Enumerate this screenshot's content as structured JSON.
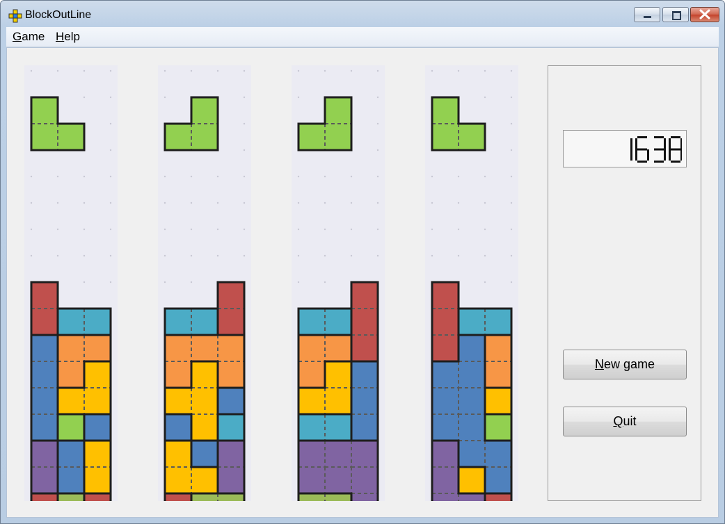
{
  "window": {
    "title": "BlockOutLine"
  },
  "menu": {
    "items": [
      {
        "label": "Game",
        "accel": "G",
        "rest": "ame"
      },
      {
        "label": "Help",
        "accel": "H",
        "rest": "elp"
      }
    ]
  },
  "score": {
    "value": "1638"
  },
  "buttons": {
    "new_game": {
      "label": "New game",
      "accel": "N",
      "rest": "ew game"
    },
    "quit": {
      "label": "Quit",
      "accel": "Q",
      "rest": "uit"
    }
  },
  "colors": {
    "green": "#92d050",
    "olive": "#9bbb59",
    "red": "#c0504d",
    "blue": "#4f81bd",
    "teal": "#4bacc6",
    "orange": "#f79646",
    "yellow": "#ffc000",
    "purple": "#8064a2",
    "board_bg": "#ebebf3",
    "grid_dot": "#c8c8d4"
  },
  "boards": [
    {
      "preview": [
        [
          0,
          0,
          "green"
        ],
        [
          0,
          1,
          "green"
        ],
        [
          1,
          1,
          "green"
        ]
      ],
      "grid": [
        [
          null,
          null,
          null
        ],
        [
          "red",
          null,
          null
        ],
        [
          "red",
          "teal",
          "teal"
        ],
        [
          "blue",
          "orange",
          "orange"
        ],
        [
          "blue",
          "orange",
          "yellow"
        ],
        [
          "blue",
          "yellow",
          "yellow"
        ],
        [
          "blue",
          "green",
          "blue"
        ],
        [
          "purple",
          "blue",
          "yellow"
        ],
        [
          "purple",
          "blue",
          "yellow"
        ],
        [
          "red",
          "olive",
          "red"
        ]
      ]
    },
    {
      "preview": [
        [
          1,
          0,
          "green"
        ],
        [
          0,
          1,
          "green"
        ],
        [
          1,
          1,
          "green"
        ]
      ],
      "grid": [
        [
          null,
          null,
          null
        ],
        [
          null,
          null,
          "red"
        ],
        [
          "teal",
          "teal",
          "red"
        ],
        [
          "orange",
          "orange",
          "orange"
        ],
        [
          "orange",
          "yellow",
          "orange"
        ],
        [
          "yellow",
          "yellow",
          "blue"
        ],
        [
          "blue",
          "yellow",
          "teal"
        ],
        [
          "yellow",
          "blue",
          "purple"
        ],
        [
          "yellow",
          "yellow",
          "purple"
        ],
        [
          "red",
          "olive",
          "olive"
        ]
      ]
    },
    {
      "preview": [
        [
          1,
          0,
          "green"
        ],
        [
          0,
          1,
          "green"
        ],
        [
          1,
          1,
          "green"
        ]
      ],
      "grid": [
        [
          null,
          null,
          null
        ],
        [
          null,
          null,
          "red"
        ],
        [
          "teal",
          "teal",
          "red"
        ],
        [
          "orange",
          "orange",
          "red"
        ],
        [
          "orange",
          "yellow",
          "blue"
        ],
        [
          "yellow",
          "yellow",
          "blue"
        ],
        [
          "teal",
          "teal",
          "blue"
        ],
        [
          "purple",
          "purple",
          "purple"
        ],
        [
          "purple",
          "purple",
          "purple"
        ],
        [
          "olive",
          "olive",
          "purple"
        ]
      ]
    },
    {
      "preview": [
        [
          0,
          0,
          "green"
        ],
        [
          0,
          1,
          "green"
        ],
        [
          1,
          1,
          "green"
        ]
      ],
      "grid": [
        [
          null,
          null,
          null
        ],
        [
          "red",
          null,
          null
        ],
        [
          "red",
          "teal",
          "teal"
        ],
        [
          "red",
          "blue",
          "orange"
        ],
        [
          "blue",
          "blue",
          "orange"
        ],
        [
          "blue",
          "blue",
          "yellow"
        ],
        [
          "blue",
          "blue",
          "green"
        ],
        [
          "purple",
          "blue",
          "blue"
        ],
        [
          "purple",
          "yellow",
          "blue"
        ],
        [
          "purple",
          "purple",
          "red"
        ]
      ]
    }
  ]
}
